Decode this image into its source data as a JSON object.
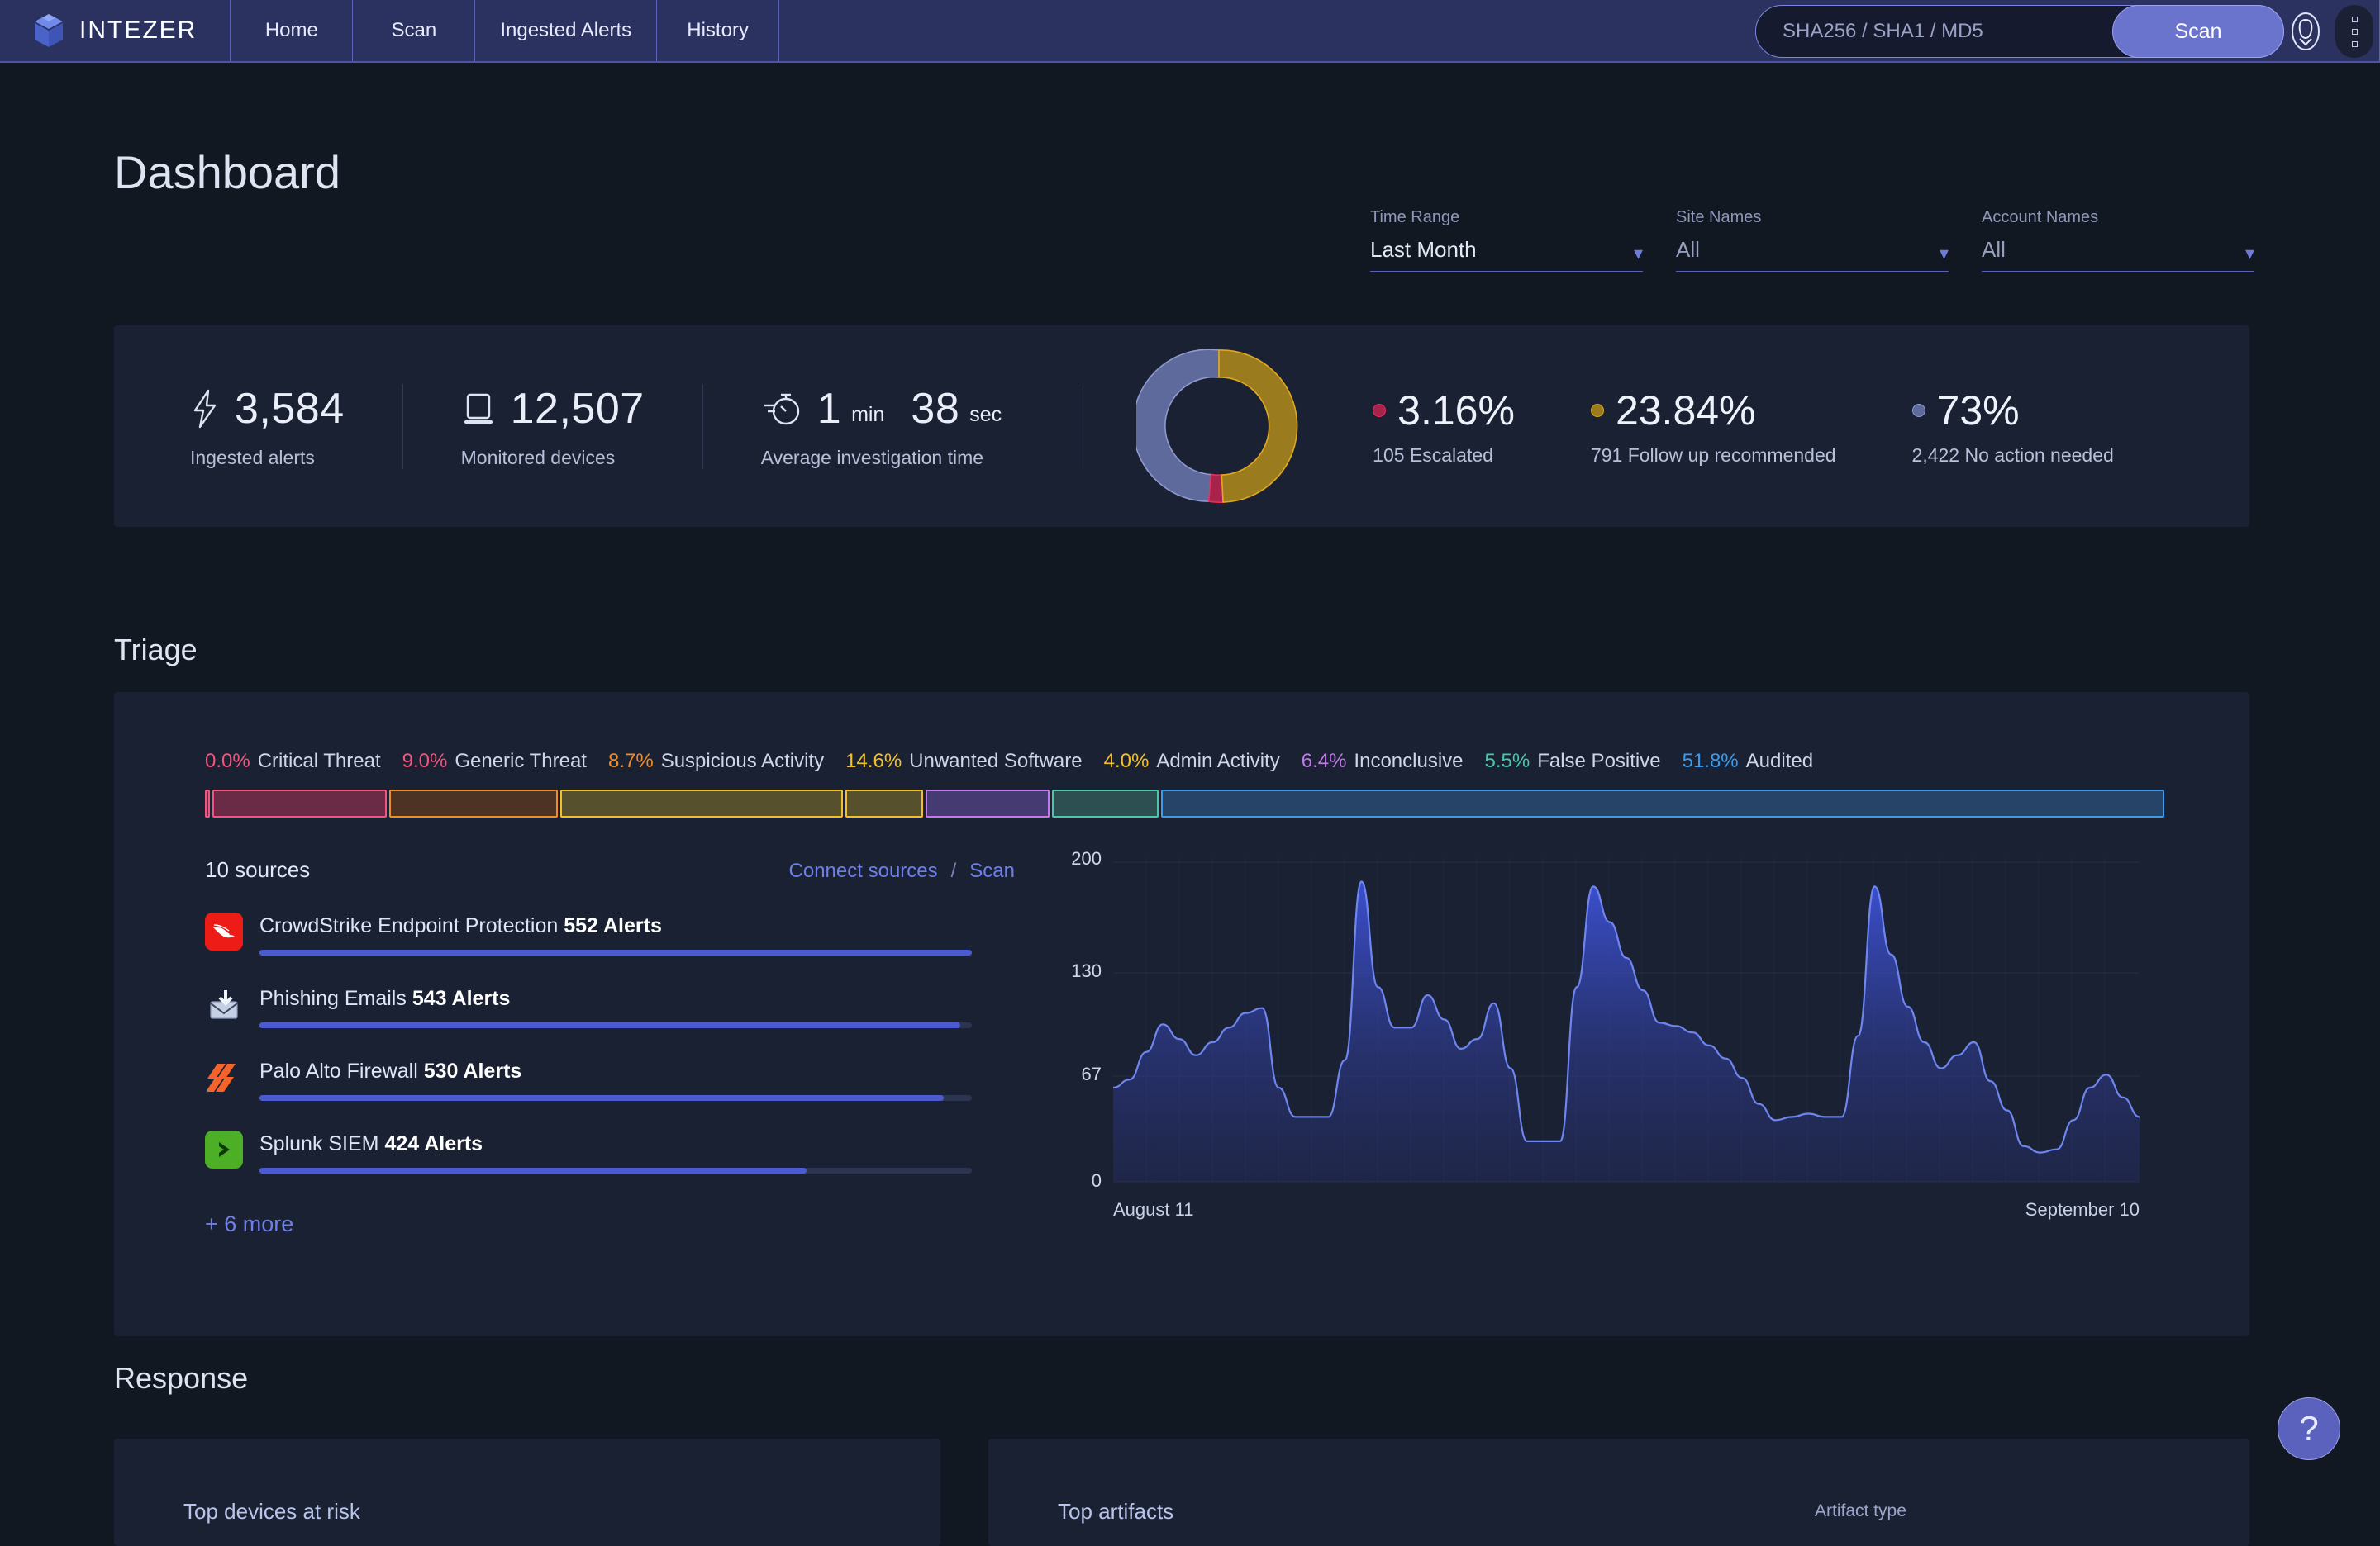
{
  "nav": {
    "brand": "INTEZER",
    "items": [
      {
        "label": "Home"
      },
      {
        "label": "Scan"
      },
      {
        "label": "Ingested Alerts"
      },
      {
        "label": "History"
      }
    ],
    "search_placeholder": "SHA256 / SHA1 / MD5",
    "search_value": "",
    "scan_button": "Scan",
    "avatar_icon": "user-avatar-icon",
    "menu_icon": "kebab-menu-icon"
  },
  "page": {
    "title": "Dashboard"
  },
  "filters": [
    {
      "label": "Time Range",
      "value": "Last Month",
      "muted": false
    },
    {
      "label": "Site Names",
      "value": "All",
      "muted": true
    },
    {
      "label": "Account Names",
      "value": "All",
      "muted": true
    }
  ],
  "stats": [
    {
      "icon": "lightning-bolt-icon",
      "value": "3,584",
      "label": "Ingested alerts"
    },
    {
      "icon": "monitor-icon",
      "value": "12,507",
      "label": "Monitored devices"
    },
    {
      "icon": "stopwatch-icon",
      "value": "1",
      "unit": "min",
      "value2": "38",
      "unit2": "sec",
      "label": "Average investigation time"
    }
  ],
  "verdict_legend": [
    {
      "pct": "3.16%",
      "sub": "105 Escalated",
      "color": "#a8234b"
    },
    {
      "pct": "23.84%",
      "sub": "791 Follow up recommended",
      "color": "#9a7b1e"
    },
    {
      "pct": "73%",
      "sub": "2,422 No action needed",
      "color": "#5e6a9c"
    }
  ],
  "sections": {
    "triage": "Triage",
    "response": "Response"
  },
  "triage_legend": [
    {
      "pct": "0.0%",
      "name": "Critical Threat",
      "color": "#f2557e"
    },
    {
      "pct": "9.0%",
      "name": "Generic Threat",
      "color": "#f2557e"
    },
    {
      "pct": "8.7%",
      "name": "Suspicious Activity",
      "color": "#f08c2b"
    },
    {
      "pct": "14.6%",
      "name": "Unwanted Software",
      "color": "#f2c02b"
    },
    {
      "pct": "4.0%",
      "name": "Admin Activity",
      "color": "#f2c02b"
    },
    {
      "pct": "6.4%",
      "name": "Inconclusive",
      "color": "#c17ae8"
    },
    {
      "pct": "5.5%",
      "name": "False Positive",
      "color": "#48c8a8"
    },
    {
      "pct": "51.8%",
      "name": "Audited",
      "color": "#3e9ae8"
    }
  ],
  "sources": {
    "count_label": "10 sources",
    "connect_label": "Connect sources",
    "separator": "/",
    "scan_label": "Scan",
    "more_label": "+ 6 more",
    "items": [
      {
        "icon": "crowdstrike-icon",
        "name": "CrowdStrike Endpoint Protection",
        "alerts": "552 Alerts",
        "value": 552
      },
      {
        "icon": "phishing-email-icon",
        "name": "Phishing Emails",
        "alerts": "543 Alerts",
        "value": 543
      },
      {
        "icon": "palo-alto-icon",
        "name": "Palo Alto Firewall",
        "alerts": "530 Alerts",
        "value": 530
      },
      {
        "icon": "splunk-icon",
        "name": "Splunk SIEM",
        "alerts": "424 Alerts",
        "value": 424
      }
    ]
  },
  "response": {
    "devices_title": "Top devices at risk",
    "artifacts_title": "Top artifacts",
    "artifact_type_label": "Artifact type"
  },
  "help": {
    "glyph": "?",
    "icon": "question-mark-icon"
  },
  "colors": {
    "accent": "#6b74cc",
    "nav_bg": "#2b3260",
    "card_bg": "#1a2133",
    "page_bg": "#121822",
    "link": "#6f7fe8"
  },
  "chart_data": [
    {
      "type": "pie",
      "title": "Alert verdict distribution",
      "labels": [
        "Escalated",
        "Follow up recommended",
        "No action needed"
      ],
      "values": [
        3.16,
        23.84,
        73.0
      ],
      "counts": [
        105,
        791,
        2422
      ],
      "colors": [
        "#a8234b",
        "#9a7b1e",
        "#5e6a9c"
      ],
      "stroke_colors": [
        "#ee2a5e",
        "#e0a820",
        "#8e9ad0"
      ],
      "legend": "right",
      "donut": true
    },
    {
      "type": "bar",
      "title": "Triage classification breakdown",
      "orientation": "horizontal-stacked",
      "categories": [
        "Critical Threat",
        "Generic Threat",
        "Suspicious Activity",
        "Unwanted Software",
        "Admin Activity",
        "Inconclusive",
        "False Positive",
        "Audited"
      ],
      "values": [
        0.0,
        9.0,
        8.7,
        14.6,
        4.0,
        6.4,
        5.5,
        51.8
      ],
      "unit": "%",
      "colors": [
        "#f2557e",
        "#f08c2b",
        "#f2c02b",
        "#f2c02b",
        "#f2c02b",
        "#c17ae8",
        "#48c8a8",
        "#3e9ae8"
      ],
      "fills": [
        "#6b2a46",
        "#4d3323",
        "#56502c",
        "#56502c",
        "#56502c",
        "#453a72",
        "#2d4f52",
        "#254468"
      ]
    },
    {
      "type": "bar",
      "title": "Alerts by source",
      "orientation": "horizontal",
      "categories": [
        "CrowdStrike Endpoint Protection",
        "Phishing Emails",
        "Palo Alto Firewall",
        "Splunk SIEM"
      ],
      "values": [
        552,
        543,
        530,
        424
      ],
      "ylabel": "Alerts",
      "xlim": [
        0,
        600
      ]
    },
    {
      "type": "area",
      "title": "Alerts over time",
      "xlabel": "",
      "ylabel": "",
      "ylim": [
        0,
        200
      ],
      "yticks": [
        0,
        67,
        130,
        200
      ],
      "x_start": "August 11",
      "x_end": "September 10",
      "grid": true,
      "series": [
        {
          "name": "Alerts",
          "values": [
            58,
            63,
            80,
            97,
            88,
            78,
            86,
            95,
            104,
            107,
            58,
            40,
            40,
            40,
            75,
            185,
            120,
            95,
            95,
            115,
            100,
            82,
            88,
            110,
            70,
            25,
            25,
            25,
            120,
            182,
            160,
            138,
            118,
            98,
            96,
            92,
            84,
            76,
            64,
            48,
            38,
            40,
            42,
            40,
            40,
            90,
            182,
            140,
            108,
            86,
            70,
            78,
            86,
            62,
            44,
            22,
            18,
            20,
            38,
            58,
            66,
            52,
            40
          ]
        }
      ]
    }
  ]
}
